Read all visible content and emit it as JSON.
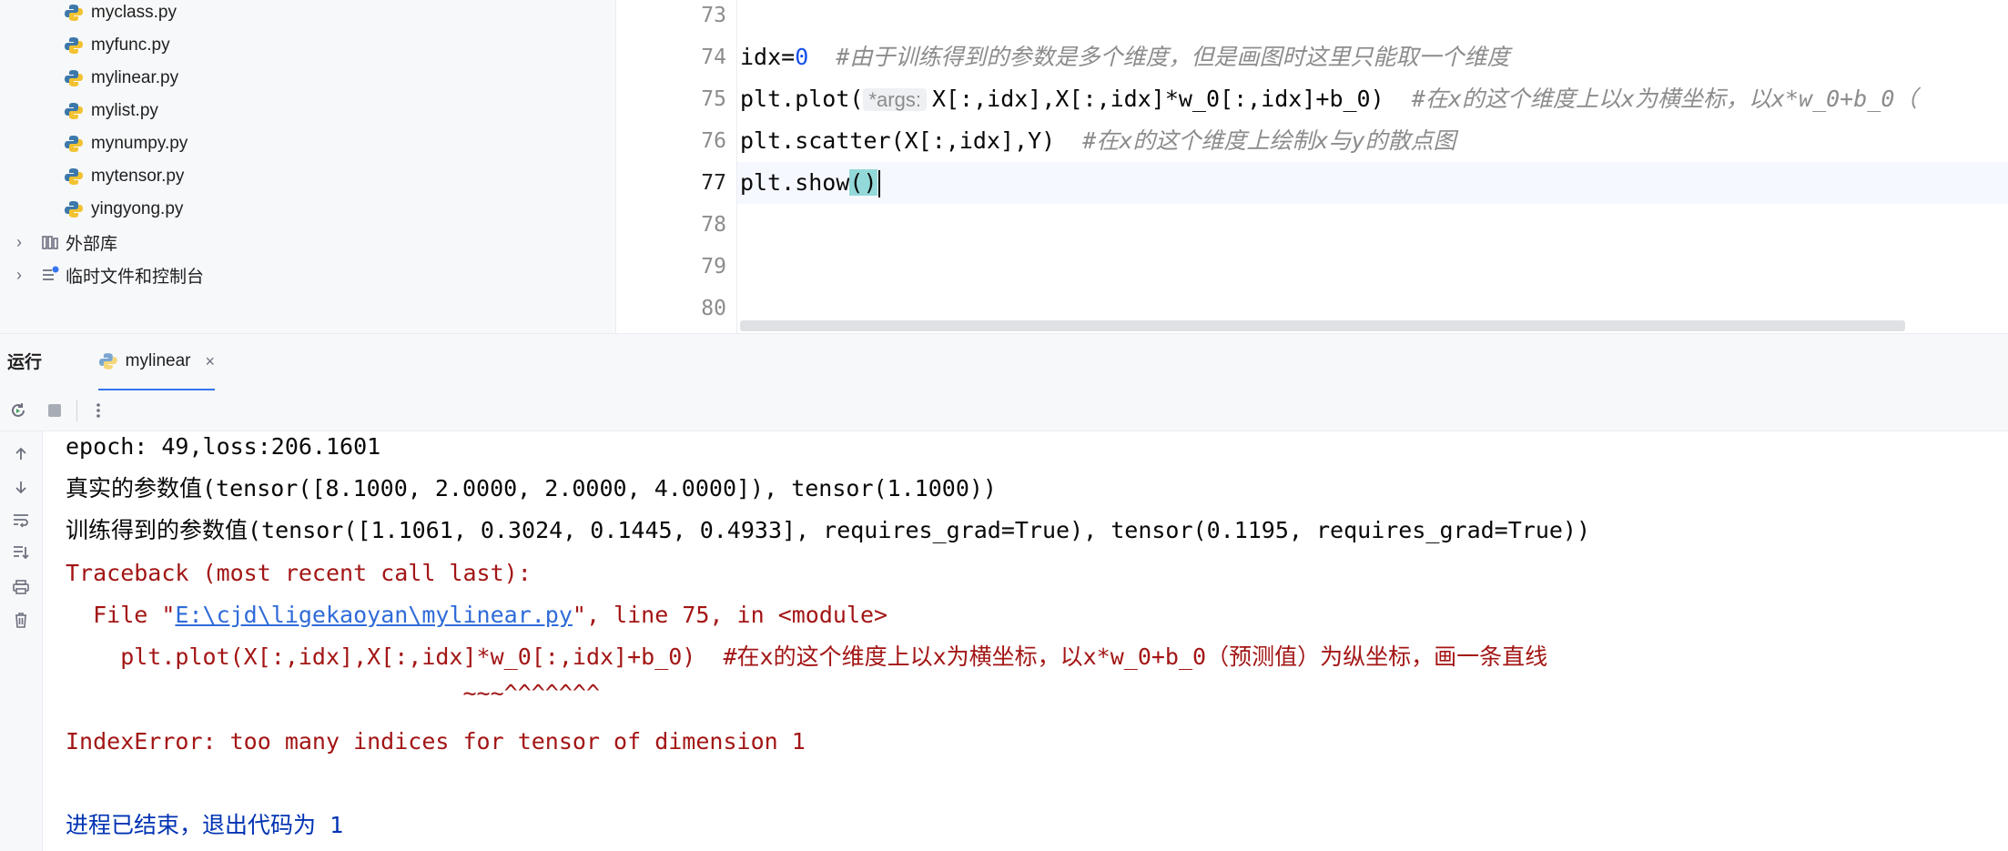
{
  "project_tree": {
    "files": [
      {
        "name": "myclass.py"
      },
      {
        "name": "myfunc.py"
      },
      {
        "name": "mylinear.py"
      },
      {
        "name": "mylist.py"
      },
      {
        "name": "mynumpy.py"
      },
      {
        "name": "mytensor.py"
      },
      {
        "name": "yingyong.py"
      }
    ],
    "external_libs": "外部库",
    "scratches": "临时文件和控制台"
  },
  "editor": {
    "line_numbers": [
      "73",
      "74",
      "75",
      "76",
      "77",
      "78",
      "79",
      "80"
    ],
    "current_line": "77",
    "line74": {
      "code": "idx=",
      "num": "0",
      "comment": "#由于训练得到的参数是多个维度，但是画图时这里只能取一个维度"
    },
    "line75": {
      "prefix": "plt.plot(",
      "hint": "*args:",
      "code": "X[:,idx],X[:,idx]*w_0[:,idx]+b_0)",
      "comment": "#在x的这个维度上以x为横坐标，以x*w_0+b_0（"
    },
    "line76": {
      "code": "plt.scatter(X[:,idx],Y)",
      "comment": "#在x的这个维度上绘制x与y的散点图"
    },
    "line77": {
      "prefix": "plt.show",
      "paren": "()"
    }
  },
  "run_panel": {
    "title": "运行",
    "tab_label": "mylinear",
    "tab_close": "×"
  },
  "console": {
    "line1": "epoch: 49,loss:206.1601",
    "line2": "真实的参数值(tensor([8.1000, 2.0000, 2.0000, 4.0000]), tensor(1.1000))",
    "line3": "训练得到的参数值(tensor([1.1061, 0.3024, 0.1445, 0.4933], requires_grad=True), tensor(0.1195, requires_grad=True))",
    "line4": "Traceback (most recent call last):",
    "line5_prefix": "  File \"",
    "line5_link": "E:\\cjd\\ligekaoyan\\mylinear.py",
    "line5_suffix": "\", line 75, in <module>",
    "line6": "    plt.plot(X[:,idx],X[:,idx]*w_0[:,idx]+b_0)  #在x的这个维度上以x为横坐标，以x*w_0+b_0（预测值）为纵坐标，画一条直线",
    "line7": "                             ~~~^^^^^^^",
    "line8": "IndexError: too many indices for tensor of dimension 1",
    "line9_text": "进程已结束，退出代码为 ",
    "line9_code": "1"
  }
}
